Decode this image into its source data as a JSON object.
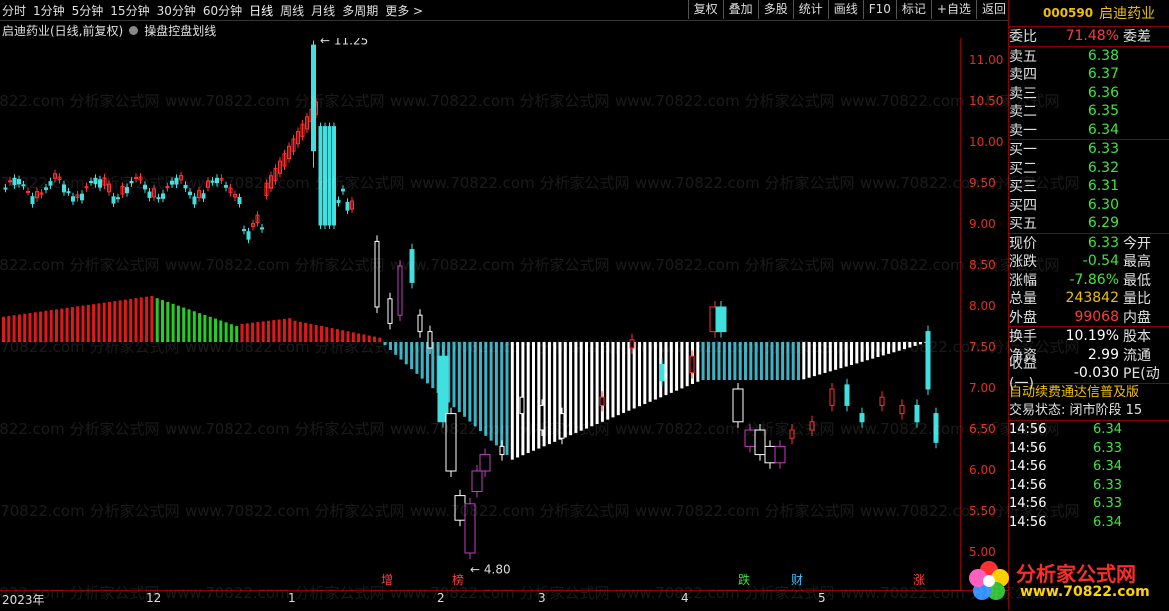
{
  "periods": [
    "分时",
    "1分钟",
    "5分钟",
    "15分钟",
    "30分钟",
    "60分钟",
    "日线",
    "周线",
    "月线",
    "多周期",
    "更多 >"
  ],
  "tools": [
    "复权",
    "叠加",
    "多股",
    "统计",
    "画线",
    "F10",
    "标记",
    "+自选",
    "返回"
  ],
  "info": {
    "title": "启迪药业(日线,前复权)",
    "indicator": "操盘控盘划线"
  },
  "yaxis_labels": [
    "11.00",
    "10.50",
    "10.00",
    "9.50",
    "9.00",
    "8.50",
    "8.00",
    "7.50",
    "7.00",
    "6.50",
    "6.00",
    "5.50",
    "5.00"
  ],
  "xaxis_labels": [
    "2023年",
    "12",
    "1",
    "2",
    "3",
    "4",
    "5"
  ],
  "annotations": {
    "high": "11.25",
    "low": "4.80"
  },
  "event_marks": [
    {
      "text": "增",
      "color": "#ff4040"
    },
    {
      "text": "榜",
      "color": "#ff4040"
    },
    {
      "text": "跌",
      "color": "#40e040"
    },
    {
      "text": "财",
      "color": "#40c0ff"
    },
    {
      "text": "涨",
      "color": "#ff4040"
    }
  ],
  "watermark": "www.70822.com 分析家公式网",
  "stock": {
    "code": "000590",
    "name": "启迪药业"
  },
  "weibi": {
    "label": "委比",
    "value": "71.48%",
    "ext": "委差"
  },
  "sells": [
    {
      "label": "卖五",
      "price": "6.38"
    },
    {
      "label": "卖四",
      "price": "6.37"
    },
    {
      "label": "卖三",
      "price": "6.36"
    },
    {
      "label": "卖二",
      "price": "6.35"
    },
    {
      "label": "卖一",
      "price": "6.34"
    }
  ],
  "buys": [
    {
      "label": "买一",
      "price": "6.33"
    },
    {
      "label": "买二",
      "price": "6.32"
    },
    {
      "label": "买三",
      "price": "6.31"
    },
    {
      "label": "买四",
      "price": "6.30"
    },
    {
      "label": "买五",
      "price": "6.29"
    }
  ],
  "quote": [
    {
      "label": "现价",
      "value": "6.33",
      "ext": "今开",
      "cls": "green"
    },
    {
      "label": "涨跌",
      "value": "-0.54",
      "ext": "最高",
      "cls": "green"
    },
    {
      "label": "涨幅",
      "value": "-7.86%",
      "ext": "最低",
      "cls": "green"
    },
    {
      "label": "总量",
      "value": "243842",
      "ext": "量比",
      "cls": "yellow"
    },
    {
      "label": "外盘",
      "value": "99068",
      "ext": "内盘",
      "cls": "red"
    }
  ],
  "fin": [
    {
      "label": "换手",
      "value": "10.19%",
      "ext": "股本"
    },
    {
      "label": "净资",
      "value": "2.99",
      "ext": "流通"
    },
    {
      "label": "收益(一)",
      "value": "-0.030",
      "ext": "PE(动"
    }
  ],
  "scroll_text": "自动续费通达信普及版",
  "trade_state": "交易状态: 闭市阶段 15",
  "ticks": [
    {
      "time": "14:56",
      "price": "6.34"
    },
    {
      "time": "14:56",
      "price": "6.33"
    },
    {
      "time": "14:56",
      "price": "6.34"
    },
    {
      "time": "14:56",
      "price": "6.33"
    },
    {
      "time": "14:56",
      "price": "6.33"
    },
    {
      "time": "14:56",
      "price": "6.34"
    }
  ],
  "logo": {
    "text": "分析家公式网",
    "url": "www.70822.com"
  }
}
